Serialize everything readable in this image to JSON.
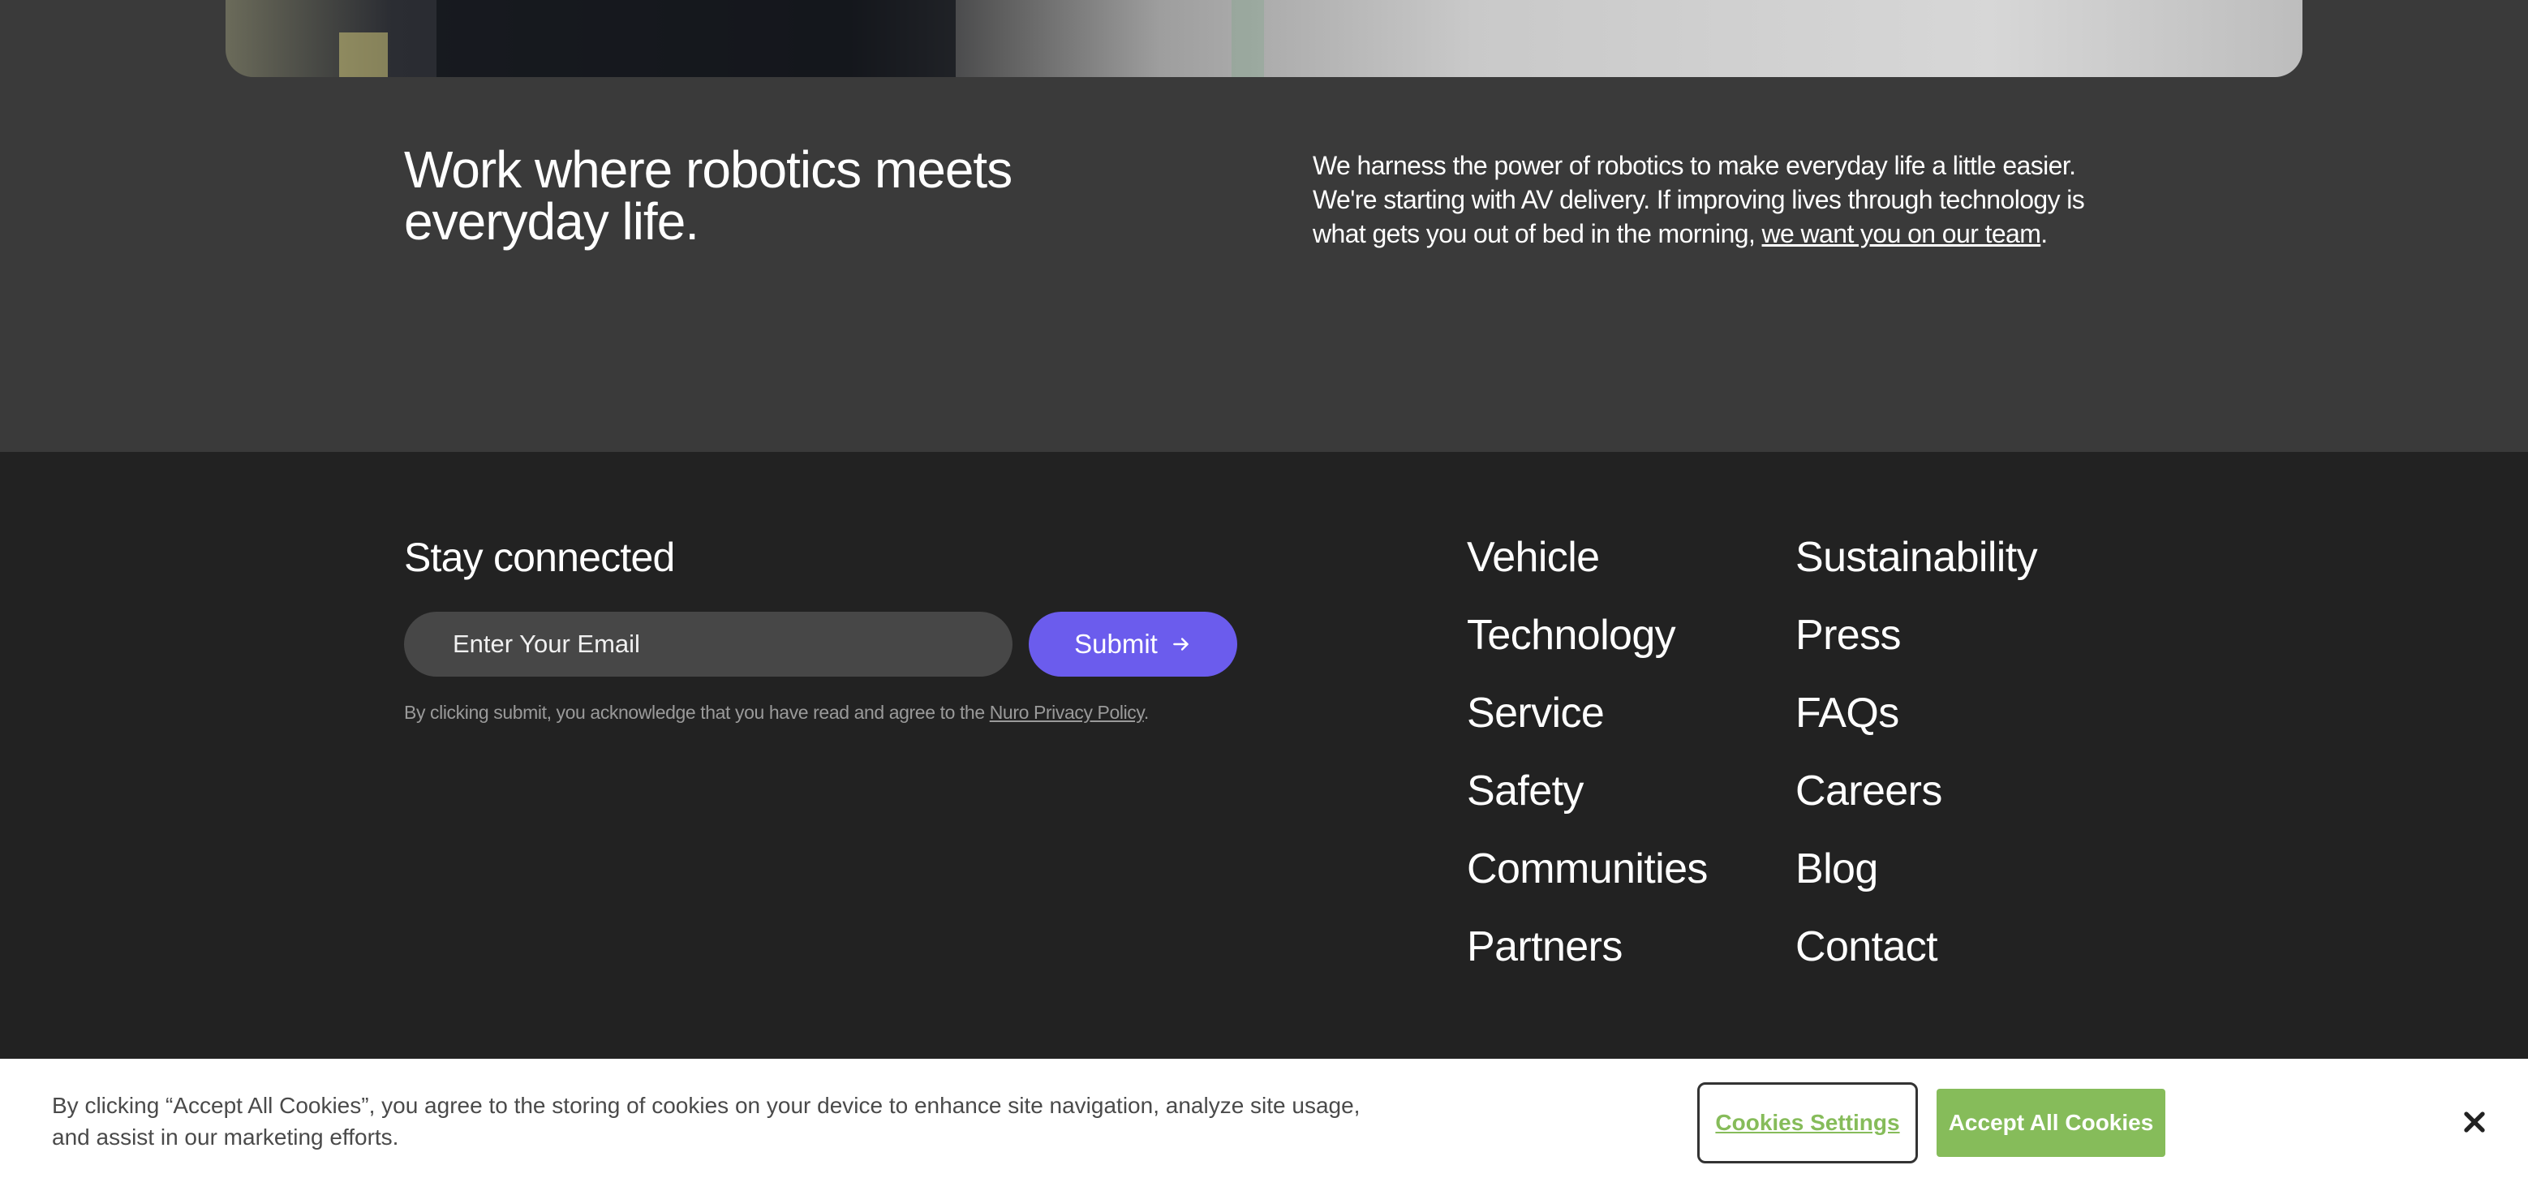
{
  "intro": {
    "heading": "Work where robotics meets everyday life.",
    "body_text": "We harness the power of robotics to make everyday life a little easier. We're starting with AV delivery. If improving lives through technology is what gets you out of bed in the morning, ",
    "body_link": "we want you on our team",
    "body_end": "."
  },
  "footer": {
    "stay_title": "Stay connected",
    "email_placeholder": "Enter Your Email",
    "submit_label": "Submit",
    "disclaimer_text": "By clicking submit, you acknowledge that you have read and agree to the ",
    "disclaimer_link": "Nuro Privacy Policy",
    "disclaimer_end": ".",
    "nav_col1": [
      "Vehicle",
      "Technology",
      "Service",
      "Safety",
      "Communities",
      "Partners"
    ],
    "nav_col2": [
      "Sustainability",
      "Press",
      "FAQs",
      "Careers",
      "Blog",
      "Contact"
    ]
  },
  "cookie": {
    "text": "By clicking “Accept All Cookies”, you agree to the storing of cookies on your device to enhance site navigation, analyze site usage, and assist in our marketing efforts.",
    "settings_label": "Cookies Settings",
    "accept_label": "Accept All Cookies"
  },
  "colors": {
    "intro_bg": "#3a3a3a",
    "footer_bg": "#222222",
    "submit_bg": "#6b5ced",
    "cookie_accent": "#86bc5a"
  }
}
